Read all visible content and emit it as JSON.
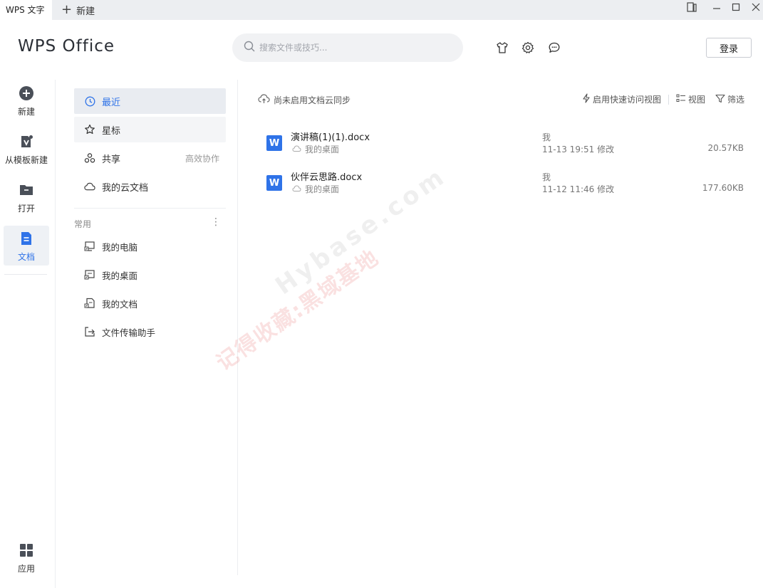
{
  "titlebar": {
    "tab_label": "WPS 文字",
    "new_tab_label": "新建"
  },
  "header": {
    "logo": "WPS Office",
    "search_placeholder": "搜索文件或技巧...",
    "login_label": "登录",
    "icons": [
      "skin-icon",
      "settings-icon",
      "feedback-icon"
    ]
  },
  "rail": {
    "items": [
      {
        "label": "新建",
        "icon": "plus-circle-icon"
      },
      {
        "label": "从模板新建",
        "icon": "template-icon"
      },
      {
        "label": "打开",
        "icon": "folder-icon"
      },
      {
        "label": "文档",
        "icon": "document-icon",
        "active": true
      }
    ],
    "apps_label": "应用"
  },
  "nav": {
    "items": [
      {
        "label": "最近",
        "icon": "clock-icon",
        "active": true
      },
      {
        "label": "星标",
        "icon": "star-icon"
      },
      {
        "label": "共享",
        "icon": "share-icon",
        "extra": "高效协作"
      },
      {
        "label": "我的云文档",
        "icon": "cloud-icon"
      }
    ],
    "section_label": "常用",
    "more_glyph": "⋮",
    "locations": [
      {
        "label": "我的电脑",
        "icon": "computer-shortcut-icon"
      },
      {
        "label": "我的桌面",
        "icon": "desktop-shortcut-icon"
      },
      {
        "label": "我的文档",
        "icon": "documents-shortcut-icon"
      },
      {
        "label": "文件传输助手",
        "icon": "transfer-icon"
      }
    ]
  },
  "main": {
    "sync_text": "尚未启用文档云同步",
    "toolbar": {
      "quick_access": "启用快速访问视图",
      "view": "视图",
      "filter": "筛选"
    },
    "files": [
      {
        "name": "演讲稿(1)(1).docx",
        "location": "我的桌面",
        "owner": "我",
        "modified": "11-13 19:51 修改",
        "size": "20.57KB"
      },
      {
        "name": "伙伴云思路.docx",
        "location": "我的桌面",
        "owner": "我",
        "modified": "11-12 11:46 修改",
        "size": "177.60KB"
      }
    ]
  },
  "watermark": {
    "line1": "记得收藏:黑域基地",
    "line2": "Hybase.com"
  },
  "colors": {
    "accent": "#2f73e8",
    "titlebar_bg": "#eceef1"
  }
}
